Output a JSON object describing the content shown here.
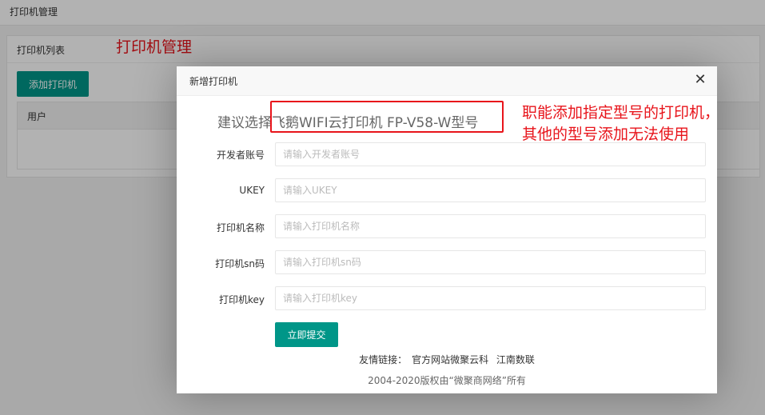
{
  "topbar": {
    "title": "打印机管理"
  },
  "panel": {
    "header": "打印机列表",
    "add_button": "添加打印机"
  },
  "table": {
    "columns": [
      "用户"
    ]
  },
  "annotations": {
    "left": "打印机管理",
    "right_line1": "职能添加指定型号的打印机，",
    "right_line2": "其他的型号添加无法使用"
  },
  "modal": {
    "title": "新增打印机",
    "close_icon": "close-icon",
    "suggestion": "建议选择飞鹅WIFI云打印机 FP-V58-W型号",
    "fields": [
      {
        "label": "开发者账号",
        "placeholder": "请输入开发者账号",
        "value": ""
      },
      {
        "label": "UKEY",
        "placeholder": "请输入UKEY",
        "value": ""
      },
      {
        "label": "打印机名称",
        "placeholder": "请输入打印机名称",
        "value": ""
      },
      {
        "label": "打印机sn码",
        "placeholder": "请输入打印机sn码",
        "value": ""
      },
      {
        "label": "打印机key",
        "placeholder": "请输入打印机key",
        "value": ""
      }
    ],
    "submit": "立即提交",
    "links": {
      "prefix": "友情链接：",
      "link1": "官方网站微聚云科",
      "link2": "江南数联"
    },
    "copyright": "2004-2020版权由“微聚商网络”所有"
  },
  "colors": {
    "accent": "#009688",
    "annotation": "#e8141b"
  }
}
